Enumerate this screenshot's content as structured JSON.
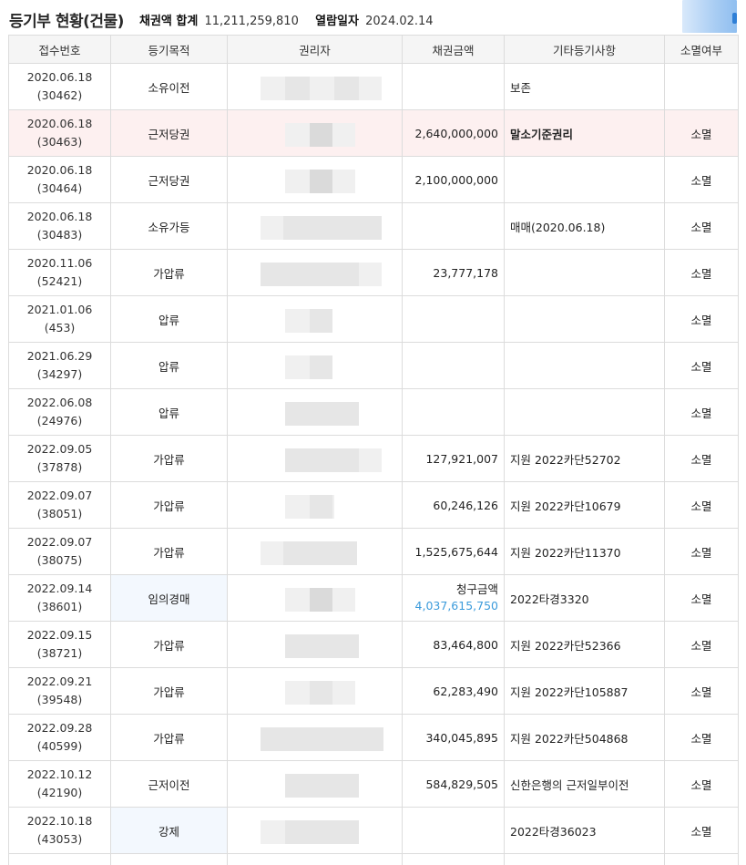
{
  "header": {
    "title": "등기부 현황(건물)",
    "sum_label": "채권액 합계",
    "sum_value": "11,211,259,810",
    "date_label": "열람일자",
    "date_value": "2024.02.14"
  },
  "columns": [
    "접수번호",
    "등기목적",
    "권리자",
    "채권금액",
    "기타등기사항",
    "소멸여부"
  ],
  "rows": [
    {
      "date": "2020.06.18",
      "no": "(30462)",
      "purpose": "소유이전",
      "amount": "",
      "note": "보존",
      "status": ""
    },
    {
      "date": "2020.06.18",
      "no": "(30463)",
      "purpose": "근저당권",
      "amount": "2,640,000,000",
      "note": "말소기준권리",
      "status": "소멸"
    },
    {
      "date": "2020.06.18",
      "no": "(30464)",
      "purpose": "근저당권",
      "amount": "2,100,000,000",
      "note": "",
      "status": "소멸"
    },
    {
      "date": "2020.06.18",
      "no": "(30483)",
      "purpose": "소유가등",
      "amount": "",
      "note": "매매(2020.06.18)",
      "status": "소멸"
    },
    {
      "date": "2020.11.06",
      "no": "(52421)",
      "purpose": "가압류",
      "amount": "23,777,178",
      "note": "",
      "status": "소멸"
    },
    {
      "date": "2021.01.06",
      "no": "(453)",
      "purpose": "압류",
      "amount": "",
      "note": "",
      "status": "소멸"
    },
    {
      "date": "2021.06.29",
      "no": "(34297)",
      "purpose": "압류",
      "amount": "",
      "note": "",
      "status": "소멸"
    },
    {
      "date": "2022.06.08",
      "no": "(24976)",
      "purpose": "압류",
      "amount": "",
      "note": "",
      "status": "소멸"
    },
    {
      "date": "2022.09.05",
      "no": "(37878)",
      "purpose": "가압류",
      "amount": "127,921,007",
      "note": "지원 2022카단52702",
      "status": "소멸"
    },
    {
      "date": "2022.09.07",
      "no": "(38051)",
      "purpose": "가압류",
      "amount": "60,246,126",
      "note": "지원 2022카단10679",
      "status": "소멸"
    },
    {
      "date": "2022.09.07",
      "no": "(38075)",
      "purpose": "가압류",
      "amount": "1,525,675,644",
      "note": "지원 2022카단11370",
      "status": "소멸"
    },
    {
      "date": "2022.09.14",
      "no": "(38601)",
      "purpose": "임의경매",
      "claim_label": "청구금액",
      "amount": "4,037,615,750",
      "note": "2022타경3320",
      "status": "소멸"
    },
    {
      "date": "2022.09.15",
      "no": "(38721)",
      "purpose": "가압류",
      "amount": "83,464,800",
      "note": "지원 2022카단52366",
      "status": "소멸"
    },
    {
      "date": "2022.09.21",
      "no": "(39548)",
      "purpose": "가압류",
      "amount": "62,283,490",
      "note": "지원 2022카단105887",
      "status": "소멸"
    },
    {
      "date": "2022.09.28",
      "no": "(40599)",
      "purpose": "가압류",
      "amount": "340,045,895",
      "note": "지원 2022카단504868",
      "status": "소멸"
    },
    {
      "date": "2022.10.12",
      "no": "(42190)",
      "purpose": "근저이전",
      "amount": "584,829,505",
      "note": "신한은행의 근저일부이전",
      "status": "소멸"
    },
    {
      "date": "2022.10.18",
      "no": "(43053)",
      "purpose": "강제",
      "amount": "",
      "note": "2022타경36023",
      "status": "소멸"
    }
  ],
  "colors": {
    "highlight_row": "#fdf0f0",
    "blue_cell": "#f3f8fe",
    "claim_amount": "#3c9bdb",
    "header_bg": "#f5f5f5",
    "border": "#dcdcdc"
  }
}
